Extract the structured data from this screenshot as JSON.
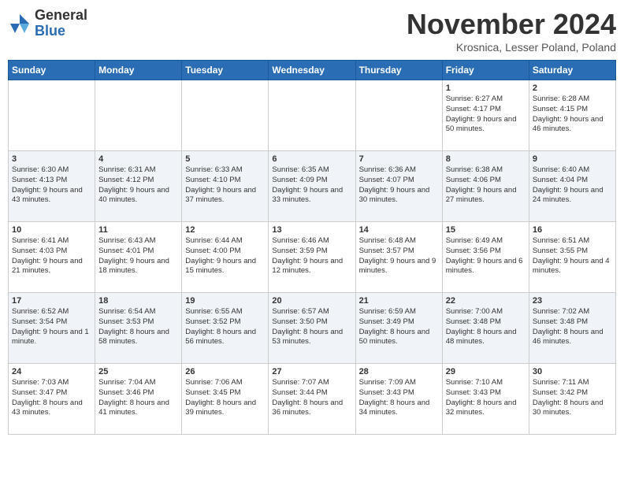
{
  "logo": {
    "general": "General",
    "blue": "Blue"
  },
  "header": {
    "month": "November 2024",
    "location": "Krosnica, Lesser Poland, Poland"
  },
  "weekdays": [
    "Sunday",
    "Monday",
    "Tuesday",
    "Wednesday",
    "Thursday",
    "Friday",
    "Saturday"
  ],
  "weeks": [
    [
      {
        "day": "",
        "info": ""
      },
      {
        "day": "",
        "info": ""
      },
      {
        "day": "",
        "info": ""
      },
      {
        "day": "",
        "info": ""
      },
      {
        "day": "",
        "info": ""
      },
      {
        "day": "1",
        "info": "Sunrise: 6:27 AM\nSunset: 4:17 PM\nDaylight: 9 hours and 50 minutes."
      },
      {
        "day": "2",
        "info": "Sunrise: 6:28 AM\nSunset: 4:15 PM\nDaylight: 9 hours and 46 minutes."
      }
    ],
    [
      {
        "day": "3",
        "info": "Sunrise: 6:30 AM\nSunset: 4:13 PM\nDaylight: 9 hours and 43 minutes."
      },
      {
        "day": "4",
        "info": "Sunrise: 6:31 AM\nSunset: 4:12 PM\nDaylight: 9 hours and 40 minutes."
      },
      {
        "day": "5",
        "info": "Sunrise: 6:33 AM\nSunset: 4:10 PM\nDaylight: 9 hours and 37 minutes."
      },
      {
        "day": "6",
        "info": "Sunrise: 6:35 AM\nSunset: 4:09 PM\nDaylight: 9 hours and 33 minutes."
      },
      {
        "day": "7",
        "info": "Sunrise: 6:36 AM\nSunset: 4:07 PM\nDaylight: 9 hours and 30 minutes."
      },
      {
        "day": "8",
        "info": "Sunrise: 6:38 AM\nSunset: 4:06 PM\nDaylight: 9 hours and 27 minutes."
      },
      {
        "day": "9",
        "info": "Sunrise: 6:40 AM\nSunset: 4:04 PM\nDaylight: 9 hours and 24 minutes."
      }
    ],
    [
      {
        "day": "10",
        "info": "Sunrise: 6:41 AM\nSunset: 4:03 PM\nDaylight: 9 hours and 21 minutes."
      },
      {
        "day": "11",
        "info": "Sunrise: 6:43 AM\nSunset: 4:01 PM\nDaylight: 9 hours and 18 minutes."
      },
      {
        "day": "12",
        "info": "Sunrise: 6:44 AM\nSunset: 4:00 PM\nDaylight: 9 hours and 15 minutes."
      },
      {
        "day": "13",
        "info": "Sunrise: 6:46 AM\nSunset: 3:59 PM\nDaylight: 9 hours and 12 minutes."
      },
      {
        "day": "14",
        "info": "Sunrise: 6:48 AM\nSunset: 3:57 PM\nDaylight: 9 hours and 9 minutes."
      },
      {
        "day": "15",
        "info": "Sunrise: 6:49 AM\nSunset: 3:56 PM\nDaylight: 9 hours and 6 minutes."
      },
      {
        "day": "16",
        "info": "Sunrise: 6:51 AM\nSunset: 3:55 PM\nDaylight: 9 hours and 4 minutes."
      }
    ],
    [
      {
        "day": "17",
        "info": "Sunrise: 6:52 AM\nSunset: 3:54 PM\nDaylight: 9 hours and 1 minute."
      },
      {
        "day": "18",
        "info": "Sunrise: 6:54 AM\nSunset: 3:53 PM\nDaylight: 8 hours and 58 minutes."
      },
      {
        "day": "19",
        "info": "Sunrise: 6:55 AM\nSunset: 3:52 PM\nDaylight: 8 hours and 56 minutes."
      },
      {
        "day": "20",
        "info": "Sunrise: 6:57 AM\nSunset: 3:50 PM\nDaylight: 8 hours and 53 minutes."
      },
      {
        "day": "21",
        "info": "Sunrise: 6:59 AM\nSunset: 3:49 PM\nDaylight: 8 hours and 50 minutes."
      },
      {
        "day": "22",
        "info": "Sunrise: 7:00 AM\nSunset: 3:48 PM\nDaylight: 8 hours and 48 minutes."
      },
      {
        "day": "23",
        "info": "Sunrise: 7:02 AM\nSunset: 3:48 PM\nDaylight: 8 hours and 46 minutes."
      }
    ],
    [
      {
        "day": "24",
        "info": "Sunrise: 7:03 AM\nSunset: 3:47 PM\nDaylight: 8 hours and 43 minutes."
      },
      {
        "day": "25",
        "info": "Sunrise: 7:04 AM\nSunset: 3:46 PM\nDaylight: 8 hours and 41 minutes."
      },
      {
        "day": "26",
        "info": "Sunrise: 7:06 AM\nSunset: 3:45 PM\nDaylight: 8 hours and 39 minutes."
      },
      {
        "day": "27",
        "info": "Sunrise: 7:07 AM\nSunset: 3:44 PM\nDaylight: 8 hours and 36 minutes."
      },
      {
        "day": "28",
        "info": "Sunrise: 7:09 AM\nSunset: 3:43 PM\nDaylight: 8 hours and 34 minutes."
      },
      {
        "day": "29",
        "info": "Sunrise: 7:10 AM\nSunset: 3:43 PM\nDaylight: 8 hours and 32 minutes."
      },
      {
        "day": "30",
        "info": "Sunrise: 7:11 AM\nSunset: 3:42 PM\nDaylight: 8 hours and 30 minutes."
      }
    ]
  ]
}
